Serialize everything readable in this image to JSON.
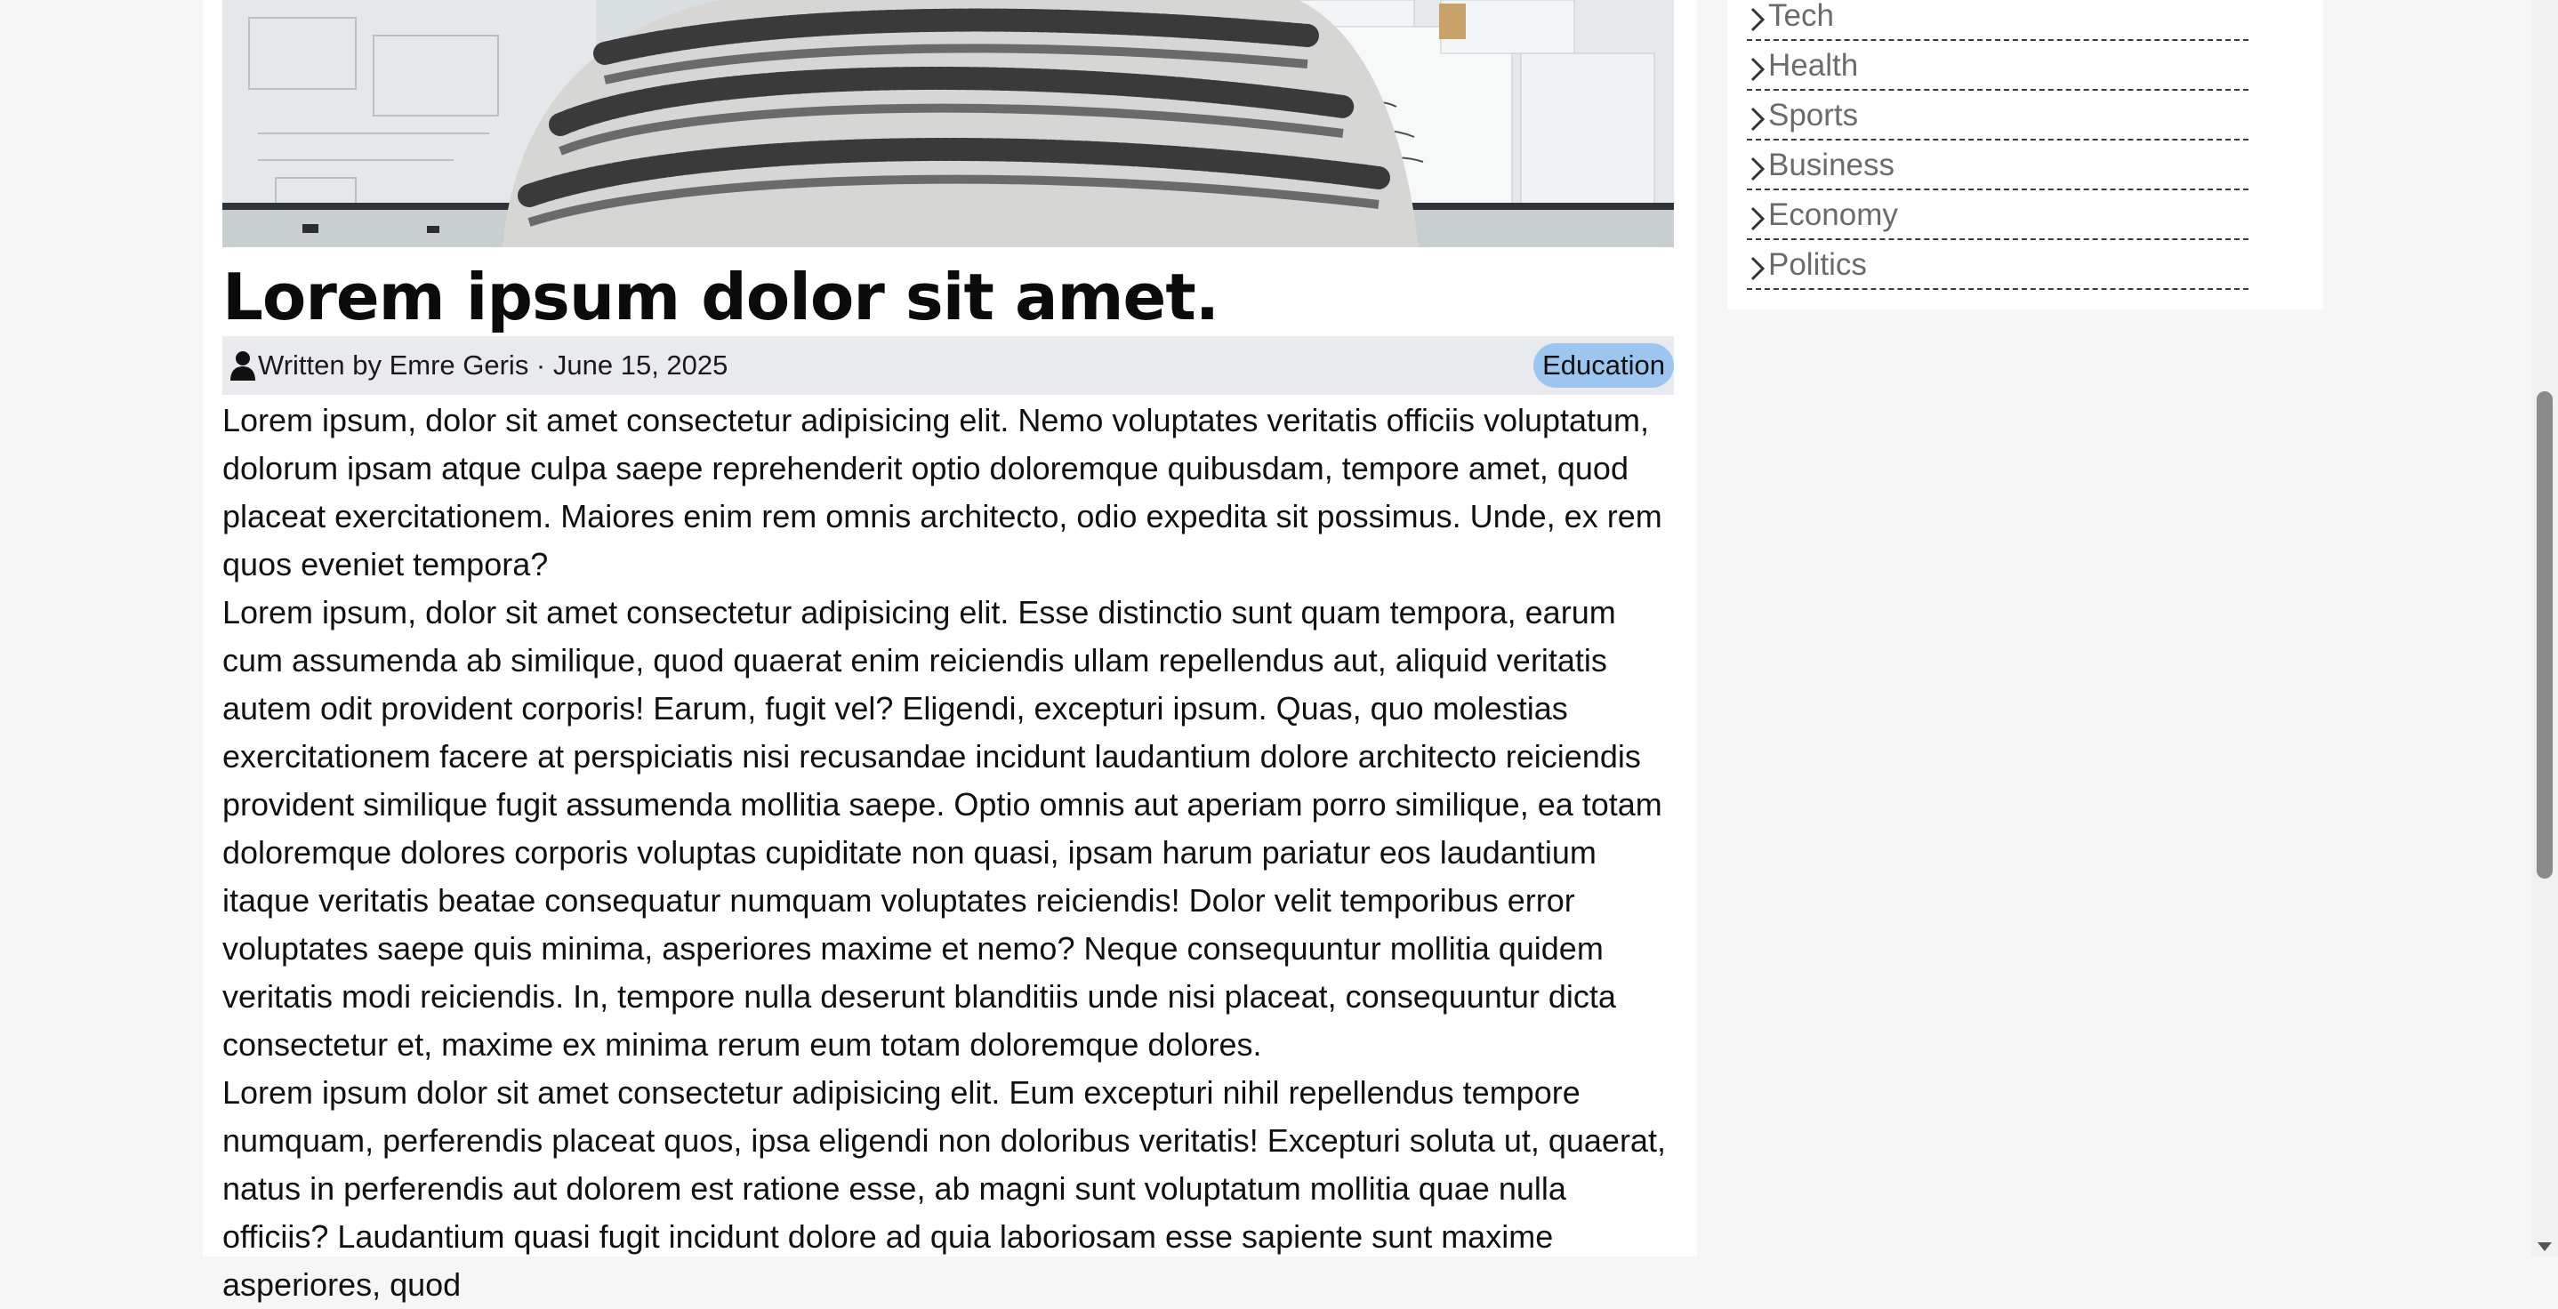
{
  "article": {
    "hero_image": "person-at-whiteboard-photo",
    "title": "Lorem ipsum dolor sit amet.",
    "meta": {
      "user_icon": "user-icon",
      "byline": "Written by Emre Geris · June 15, 2025",
      "category_tag": "Education"
    },
    "paragraphs": [
      "Lorem ipsum, dolor sit amet consectetur adipisicing elit. Nemo voluptates veritatis officiis voluptatum, dolorum ipsam atque culpa saepe reprehenderit optio doloremque quibusdam, tempore amet, quod placeat exercitationem. Maiores enim rem omnis architecto, odio expedita sit possimus. Unde, ex rem quos eveniet tempora?",
      "Lorem ipsum, dolor sit amet consectetur adipisicing elit. Esse distinctio sunt quam tempora, earum cum assumenda ab similique, quod quaerat enim reiciendis ullam repellendus aut, aliquid veritatis autem odit provident corporis! Earum, fugit vel? Eligendi, excepturi ipsum. Quas, quo molestias exercitationem facere at perspiciatis nisi recusandae incidunt laudantium dolore architecto reiciendis provident similique fugit assumenda mollitia saepe. Optio omnis aut aperiam porro similique, ea totam doloremque dolores corporis voluptas cupiditate non quasi, ipsam harum pariatur eos laudantium itaque veritatis beatae consequatur numquam voluptates reiciendis! Dolor velit temporibus error voluptates saepe quis minima, asperiores maxime et nemo? Neque consequuntur mollitia quidem veritatis modi reiciendis. In, tempore nulla deserunt blanditiis unde nisi placeat, consequuntur dicta consectetur et, maxime ex minima rerum eum totam doloremque dolores.",
      "Lorem ipsum dolor sit amet consectetur adipisicing elit. Eum excepturi nihil repellendus tempore numquam, perferendis placeat quos, ipsa eligendi non doloribus veritatis! Excepturi soluta ut, quaerat, natus in perferendis aut dolorem est ratione esse, ab magni sunt voluptatum mollitia quae nulla officiis? Laudantium quasi fugit incidunt dolore ad quia laboriosam esse sapiente sunt maxime asperiores, quod"
    ]
  },
  "sidebar": {
    "chevron_icon": "chevron-right-icon",
    "categories": [
      {
        "label": "Tech"
      },
      {
        "label": "Health"
      },
      {
        "label": "Sports"
      },
      {
        "label": "Business"
      },
      {
        "label": "Economy"
      },
      {
        "label": "Politics"
      }
    ]
  },
  "colors": {
    "tag_background": "#9cc6ef",
    "meta_background": "#e9eaed",
    "page_background": "#f6f6f7",
    "category_text": "#6b6b6b"
  }
}
